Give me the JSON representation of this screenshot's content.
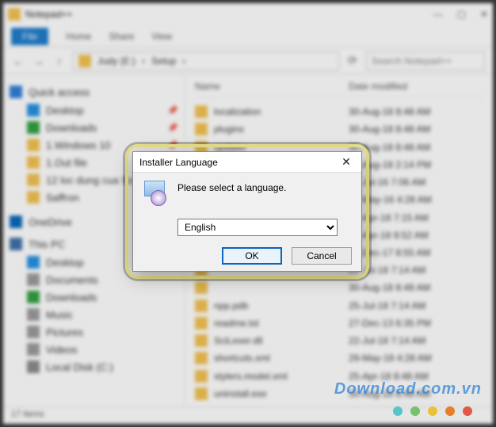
{
  "window": {
    "title": "Notepad++",
    "sys_min": "—",
    "sys_max": "▢",
    "sys_close": "✕"
  },
  "ribbon": {
    "file": "File",
    "tabs": [
      "Home",
      "Share",
      "View"
    ]
  },
  "address": {
    "nav_back": "←",
    "nav_fwd": "→",
    "nav_up": "↑",
    "crumbs": [
      "Judy (E:)",
      "Setup"
    ],
    "refresh": "⟳",
    "search_placeholder": "Search Notepad++"
  },
  "sidebar": {
    "sections": [
      {
        "icon": "i-star",
        "label": "Quick access",
        "items": [
          {
            "icon": "i-desk",
            "label": "Desktop",
            "pinned": true
          },
          {
            "icon": "i-dl",
            "label": "Downloads",
            "pinned": true
          },
          {
            "icon": "i-fold",
            "label": "1.Windows 10",
            "pinned": true
          },
          {
            "icon": "i-fold",
            "label": "1.Out file",
            "pinned": false
          },
          {
            "icon": "i-fold",
            "label": "12 loc dung cua So 1",
            "pinned": false
          },
          {
            "icon": "i-fold",
            "label": "Saffron",
            "pinned": false
          }
        ]
      },
      {
        "icon": "i-od",
        "label": "OneDrive",
        "items": []
      },
      {
        "icon": "i-pc",
        "label": "This PC",
        "items": [
          {
            "icon": "i-desk",
            "label": "Desktop"
          },
          {
            "icon": "i-doc",
            "label": "Documents"
          },
          {
            "icon": "i-dl",
            "label": "Downloads"
          },
          {
            "icon": "i-mus",
            "label": "Music"
          },
          {
            "icon": "i-pic",
            "label": "Pictures"
          },
          {
            "icon": "i-vid",
            "label": "Videos"
          },
          {
            "icon": "i-disk",
            "label": "Local Disk (C:)"
          }
        ]
      }
    ]
  },
  "content": {
    "headers": {
      "name": "Name",
      "date": "Date modified"
    },
    "rows": [
      {
        "name": "localization",
        "date": "30-Aug-18 8:48 AM"
      },
      {
        "name": "plugins",
        "date": "30-Aug-18 8:48 AM"
      },
      {
        "name": "updater",
        "date": "30-Aug-18 8:48 AM"
      },
      {
        "name": "",
        "date": "30-Aug-18 2:14 PM"
      },
      {
        "name": "",
        "date": "22-Jul-16 7:06 AM"
      },
      {
        "name": "",
        "date": "24-May-16 4:28 AM"
      },
      {
        "name": "",
        "date": "12-Apr-18 7:15 AM"
      },
      {
        "name": "",
        "date": "25-Apr-18 8:52 AM"
      },
      {
        "name": "",
        "date": "07-Dec-17 8:55 AM"
      },
      {
        "name": "",
        "date": "22-Jul-18 7:14 AM"
      },
      {
        "name": "",
        "date": "30-Aug-18 8:48 AM"
      },
      {
        "name": "npp.pdb",
        "date": "25-Jul-18 7:14 AM"
      },
      {
        "name": "readme.txt",
        "date": "27-Dec-13 6:35 PM"
      },
      {
        "name": "SciLexer.dll",
        "date": "22-Jul-18 7:14 AM"
      },
      {
        "name": "shortcuts.xml",
        "date": "29-May-18 4:28 AM"
      },
      {
        "name": "stylers.model.xml",
        "date": "25-Apr-18 8:48 AM"
      },
      {
        "name": "uninstall.exe",
        "date": "30-Aug-18 8:48 AM"
      }
    ]
  },
  "statusbar": {
    "text": "17 items"
  },
  "watermark": {
    "text": "Download.com.vn",
    "colors": [
      "#57c4c9",
      "#79c06a",
      "#e8c33a",
      "#e87d2e",
      "#df5a46"
    ]
  },
  "dialog": {
    "title": "Installer Language",
    "message": "Please select a language.",
    "selected": "English",
    "ok": "OK",
    "cancel": "Cancel",
    "close": "✕"
  }
}
